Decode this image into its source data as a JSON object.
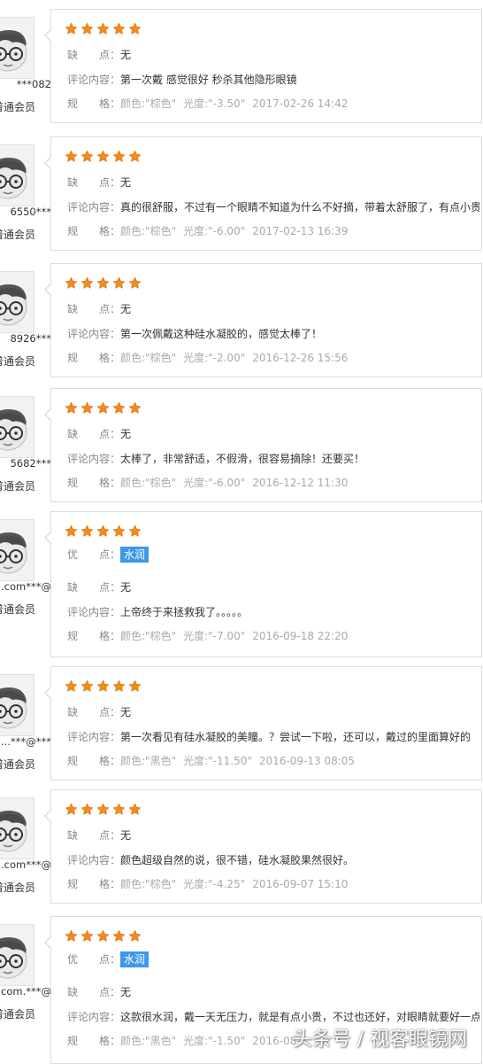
{
  "labels": {
    "pro": "优　　点：",
    "con": "缺　　点：",
    "comment": "评论内容：",
    "spec": "规　　格："
  },
  "reviews": [
    {
      "user": "082***",
      "level": "普通会员",
      "con": "无",
      "comment": "第一次戴 感觉很好 秒杀其他隐形眼镜",
      "color": "颜色:\"棕色\"",
      "power": "光度:\"-3.50\"",
      "time": "2017-02-26 14:42"
    },
    {
      "user": "***6550",
      "level": "普通会员",
      "con": "无",
      "comment": "真的很舒服，不过有一个眼睛不知道为什么不好摘，带着太舒服了，有点小贵",
      "color": "颜色:\"棕色\"",
      "power": "光度:\"-6.00\"",
      "time": "2017-02-13 16:39"
    },
    {
      "user": "***8926",
      "level": "普通会员",
      "con": "无",
      "comment": "第一次佩戴这种硅水凝胶的，感觉太棒了！",
      "color": "颜色:\"棕色\"",
      "power": "光度:\"-2.00\"",
      "time": "2016-12-26 15:56"
    },
    {
      "user": "***5682",
      "level": "普通会员",
      "con": "无",
      "comment": "太棒了，非常舒适，不假滑，很容易摘除！还要买！",
      "color": "颜色:\"棕色\"",
      "power": "光度:\"-6.00\"",
      "time": "2016-12-12 11:30"
    },
    {
      "user": "@***l.com",
      "level": "普通会员",
      "pro": "水润",
      "con": "无",
      "comment": "上帝终于来拯救我了。。。。。",
      "color": "颜色:\"棕色\"",
      "power": "光度:\"-7.00\"",
      "time": "2016-09-18 22:20"
    },
    {
      "user": "***@***...",
      "level": "普通会员",
      "con": "无",
      "comment": "第一次看见有硅水凝胶的美瞳。？尝试一下啦，还可以，戴过的里面算好的",
      "color": "颜色:\"黑色\"",
      "power": "光度:\"-11.50\"",
      "time": "2016-09-13 08:05"
    },
    {
      "user": "@***l.com",
      "level": "普通会员",
      "con": "无",
      "comment": "颜色超级自然的说，很不错，硅水凝胶果然很好。",
      "color": "颜色:\"棕色\"",
      "power": "光度:\"-4.25\"",
      "time": "2016-09-07 15:10"
    },
    {
      "user": "@***.com",
      "level": "普通会员",
      "pro": "水润",
      "con": "无",
      "comment": "这款很水润，戴一天无压力，就是有点小贵，不过也还好，对眼睛就要好一点",
      "color": "颜色:\"黑色\"",
      "power": "光度:\"-1.50\"",
      "time": "2016-08-"
    }
  ],
  "rating": 5,
  "colors": {
    "star": "#f38a1a",
    "tag": "#3d98e8"
  },
  "watermark": "头条号 / 视客眼镜网"
}
